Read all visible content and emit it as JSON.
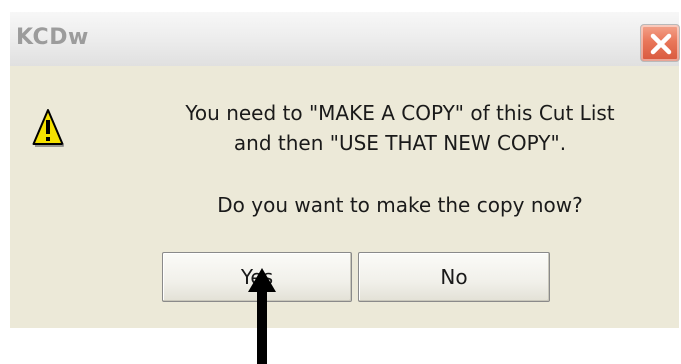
{
  "window": {
    "title": "KCDw"
  },
  "icons": {
    "close": "close-x-icon",
    "warning": "warning-triangle-icon",
    "pointer": "pointer-arrow"
  },
  "message": {
    "line1": "You need to \"MAKE A COPY\" of this Cut List",
    "line2": "and then \"USE THAT NEW COPY\".",
    "question": "Do you want to make the copy now?"
  },
  "buttons": {
    "yes": "Yes",
    "no": "No"
  },
  "colors": {
    "dialog_background": "#ece9d8",
    "close_button": "#e0664a",
    "warning_fill": "#f5e100",
    "arrow": "#000000"
  }
}
